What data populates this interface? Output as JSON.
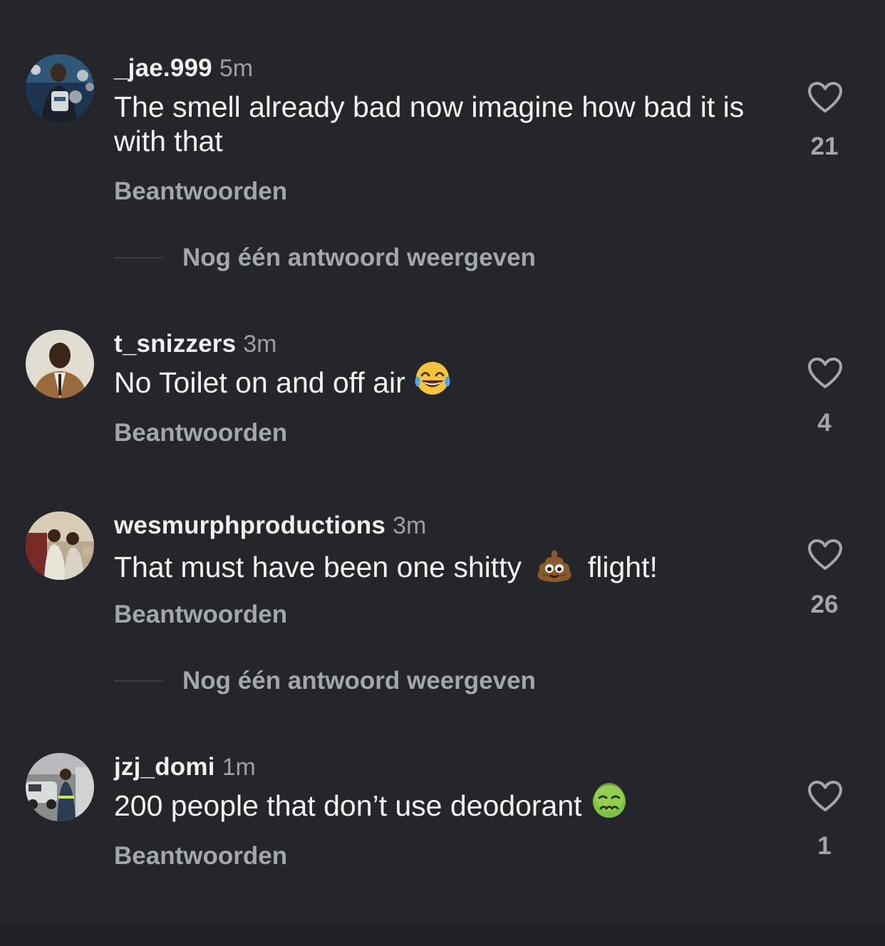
{
  "comments": [
    {
      "username": "_jae.999",
      "time": "5m",
      "text": "The smell already bad now imagine how bad it is with that",
      "emoji": "",
      "reply_label": "Beantwoorden",
      "likes": "21",
      "more_replies": "Nog één antwoord weergeven"
    },
    {
      "username": "t_snizzers",
      "time": "3m",
      "text": "No Toilet on and off air",
      "emoji": "face-with-tears-of-joy",
      "reply_label": "Beantwoorden",
      "likes": "4"
    },
    {
      "username": "wesmurphproductions",
      "time": "3m",
      "text_before": "That must have been one shitty",
      "emoji": "pile-of-poo",
      "text_after": "flight!",
      "reply_label": "Beantwoorden",
      "likes": "26",
      "more_replies": "Nog één antwoord weergeven"
    },
    {
      "username": "jzj_domi",
      "time": "1m",
      "text": "200 people that don’t use deodorant",
      "emoji": "nauseated-face",
      "reply_label": "Beantwoorden",
      "likes": "1"
    }
  ],
  "colors": {
    "background": "#24262b",
    "text": "#f4f4f4",
    "muted": "#a2a6ad"
  },
  "icons": {
    "like": "heart-outline-icon"
  }
}
